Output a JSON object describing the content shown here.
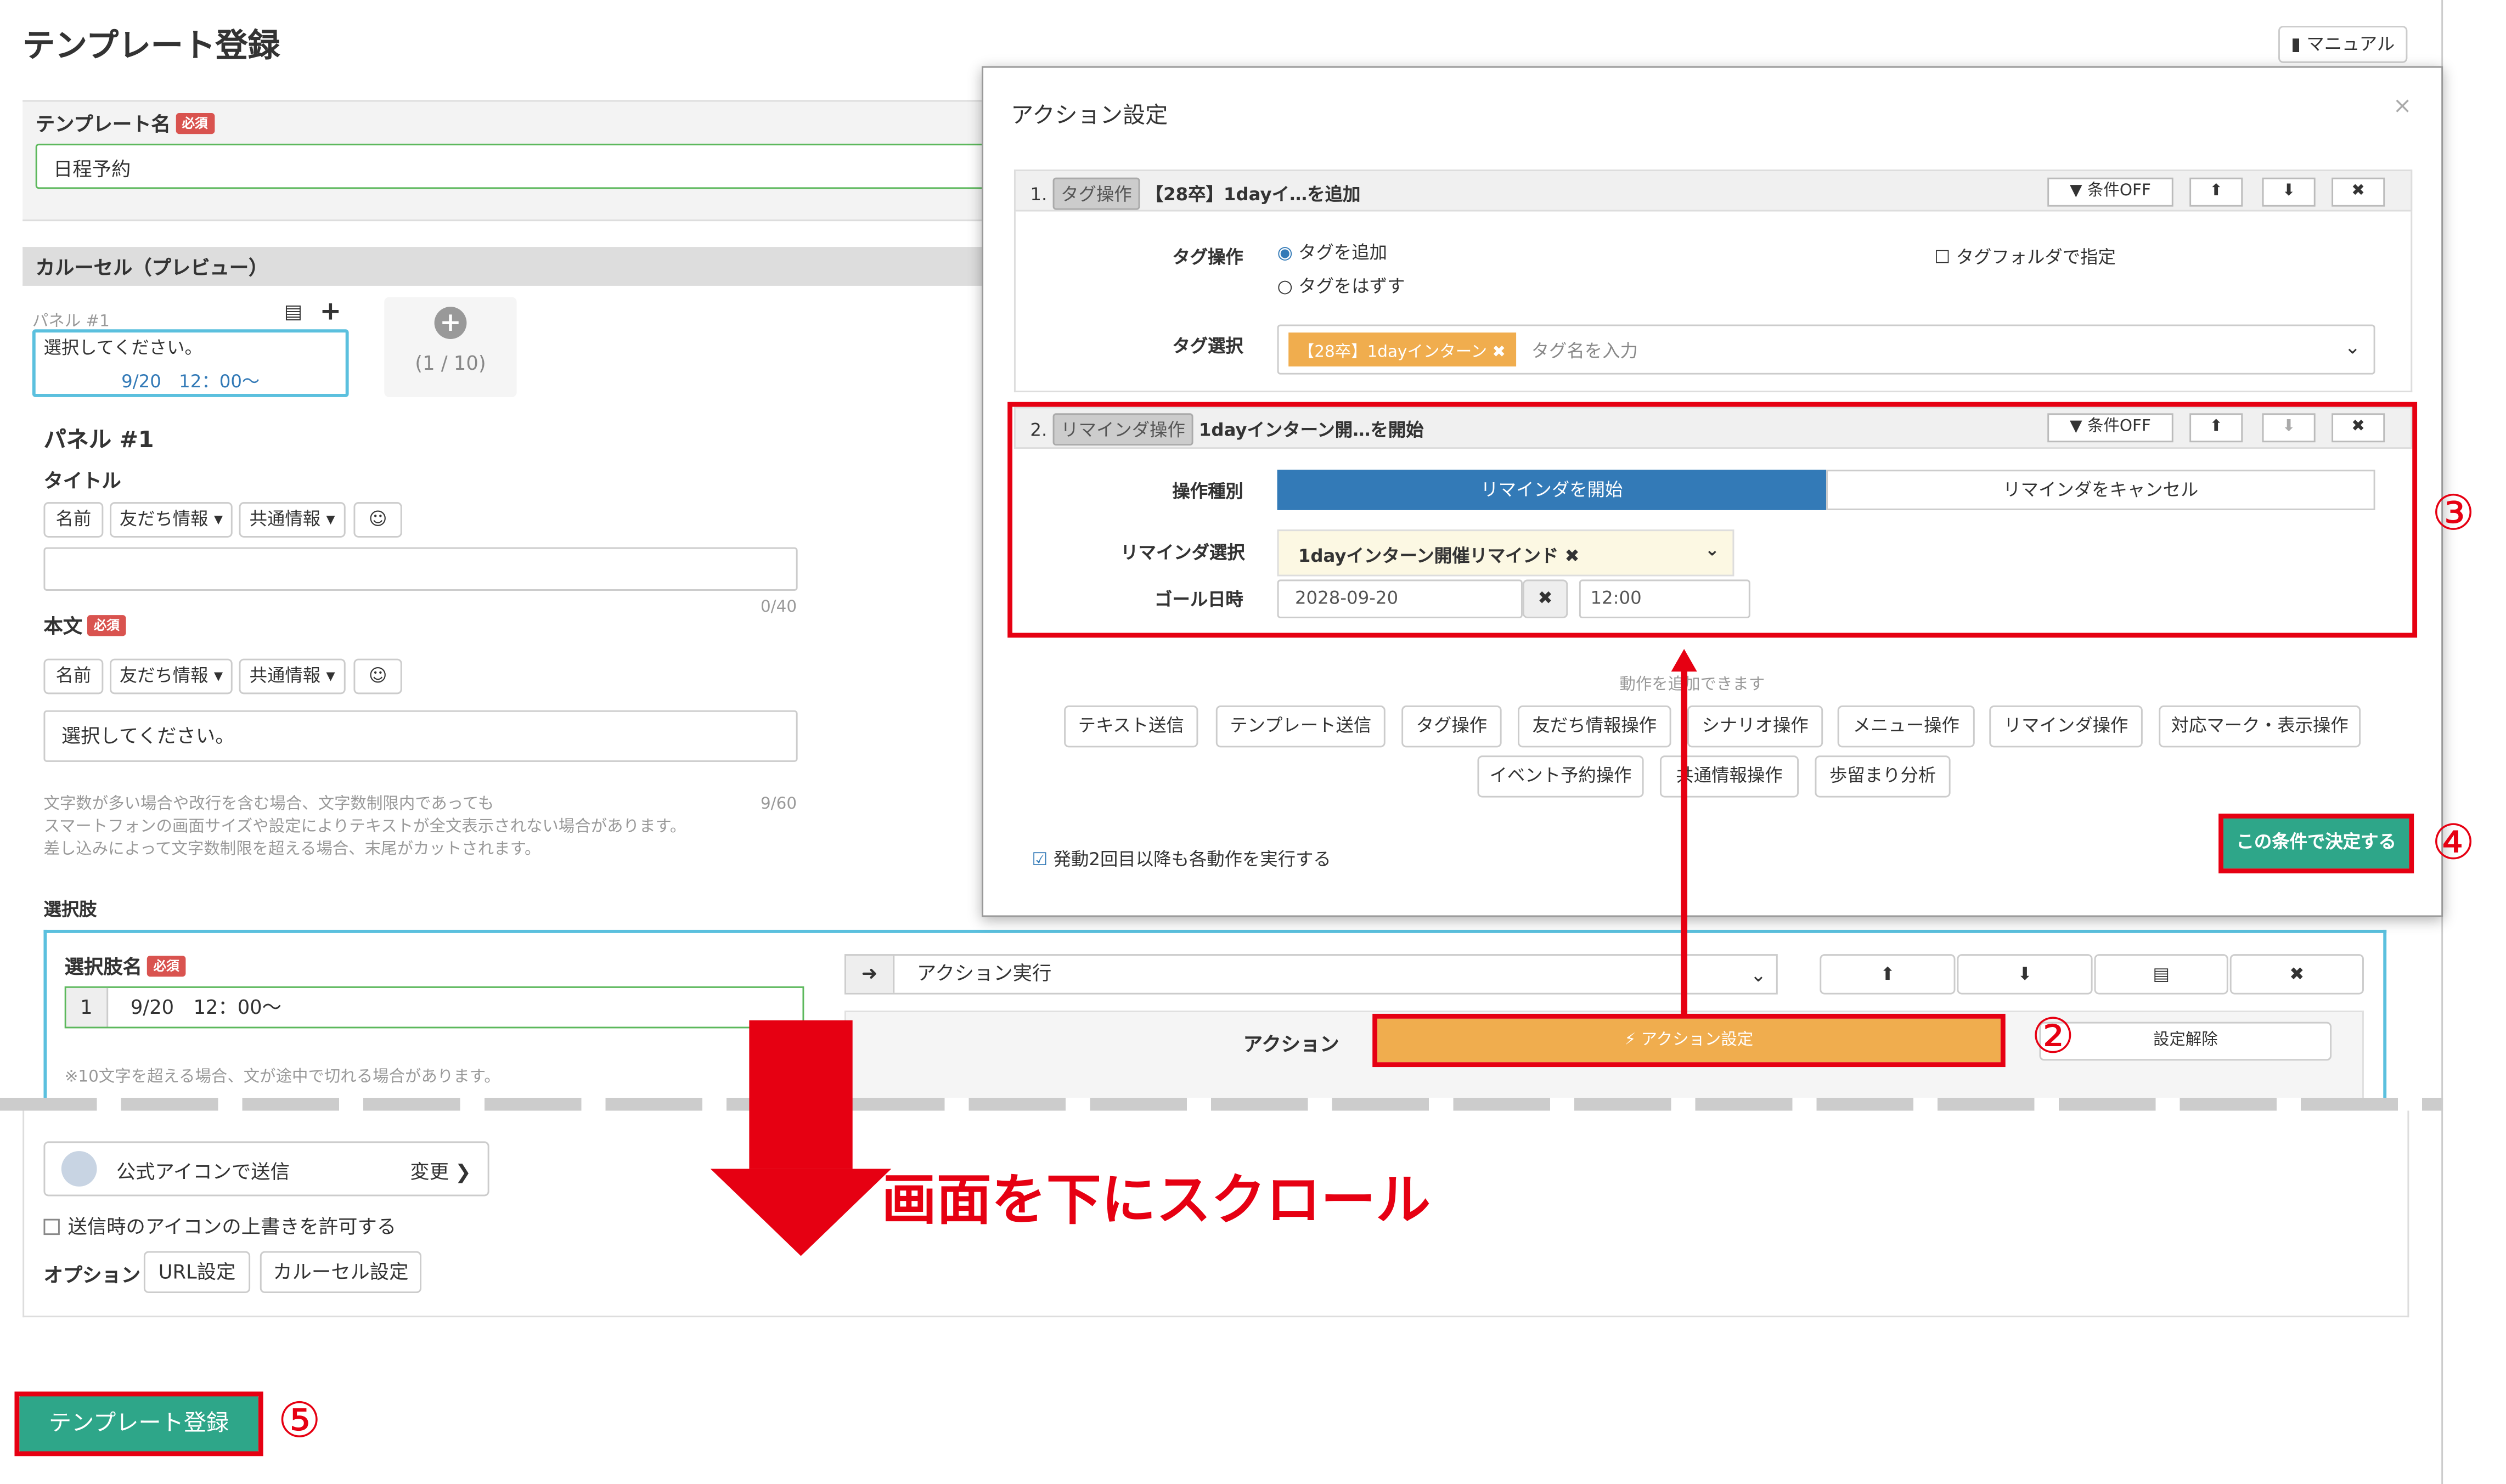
{
  "page": {
    "title": "テンプレート登録",
    "manual_button": "マニュアル"
  },
  "template_name": {
    "label": "テンプレート名",
    "required": "必須",
    "value": "日程予約"
  },
  "carousel": {
    "header": "カルーセル（プレビュー）",
    "panel_label": "パネル #1",
    "panel_text": "選択してください。",
    "panel_date": "9/20　12：00～",
    "counter": "(1 / 10)"
  },
  "panel": {
    "heading": "パネル #1",
    "title_label": "タイトル",
    "body_label": "本文",
    "required": "必須",
    "btn_name": "名前",
    "btn_friend": "友だち情報 ▾",
    "btn_common": "共通情報 ▾",
    "title_count": "0/40",
    "body_value": "選択してください。",
    "body_count": "9/60",
    "note": [
      "文字数が多い場合や改行を含む場合、文字数制限内であっても",
      "スマートフォンの画面サイズや設定によりテキストが全文表示されない場合があります。",
      "差し込みによって文字数制限を超える場合、末尾がカットされます。"
    ]
  },
  "choices": {
    "header": "選択肢",
    "name_label": "選択肢名",
    "required": "必須",
    "num": "1",
    "value": "9/20　12：00～",
    "note": "※10文字を超える場合、文が途中で切れる場合があります。",
    "action_select": "アクション実行",
    "action_label": "アクション",
    "action_button": "⚡ アクション設定",
    "unset_button": "設定解除"
  },
  "bottom": {
    "icon_send": "公式アイコンで送信",
    "change": "変更 ❯",
    "allow_override": "送信時のアイコンの上書きを許可する",
    "option_label": "オプション",
    "url_setting": "URL設定",
    "carousel_setting": "カルーセル設定",
    "register_button": "テンプレート登録"
  },
  "modal": {
    "title": "アクション設定",
    "row1": {
      "num": "1.",
      "chip": "タグ操作",
      "text": "【28卒】1dayイ…を追加",
      "cond": "▼ 条件OFF",
      "op_label": "タグ操作",
      "radio_add": "タグを追加",
      "radio_remove": "タグをはずす",
      "folder": "タグフォルダで指定",
      "select_label": "タグ選択",
      "tag": "【28卒】1dayインターン ✖",
      "placeholder": "タグ名を入力"
    },
    "row2": {
      "num": "2.",
      "chip": "リマインダ操作",
      "text": "1dayインターン開…を開始",
      "cond": "▼ 条件OFF",
      "type_label": "操作種別",
      "start": "リマインダを開始",
      "cancel": "リマインダをキャンセル",
      "select_label": "リマインダ選択",
      "selected": "1dayインターン開催リマインド ✖",
      "goal_label": "ゴール日時",
      "date": "2028-09-20",
      "time": "12:00"
    },
    "add_hint": "動作を追加できます",
    "actions": [
      "テキスト送信",
      "テンプレート送信",
      "タグ操作",
      "友だち情報操作",
      "シナリオ操作",
      "メニュー操作",
      "リマインダ操作",
      "対応マーク・表示操作",
      "イベント予約操作",
      "共通情報操作",
      "歩留まり分析"
    ],
    "repeat_check": "発動2回目以降も各動作を実行する",
    "decide": "この条件で決定する"
  },
  "annotations": {
    "scroll": "画面を下にスクロール",
    "n2": "②",
    "n3": "③",
    "n4": "④",
    "n5": "⑤"
  },
  "colors": {
    "accent_red": "#e60012",
    "primary_blue": "#337ab7",
    "teal": "#2ea689",
    "orange": "#f0ad4e"
  }
}
